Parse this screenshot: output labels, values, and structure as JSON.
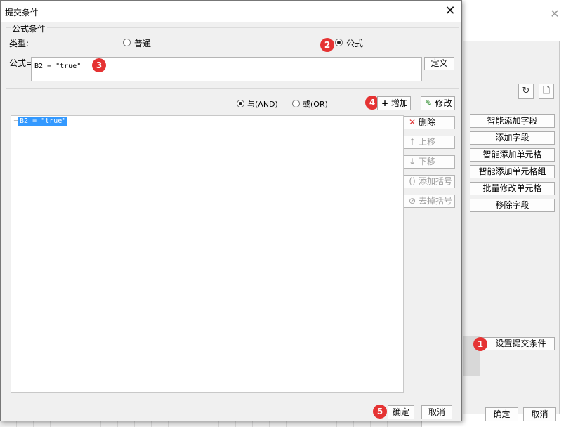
{
  "background_window": {
    "buttons": [
      "智能添加字段",
      "添加字段",
      "智能添加单元格",
      "智能添加单元格组",
      "批量修改单元格",
      "移除字段"
    ],
    "set_submit_button": "设置提交条件",
    "ok": "确定",
    "cancel": "取消"
  },
  "dialog": {
    "title": "提交条件",
    "group_label": "公式条件",
    "type_label": "类型:",
    "type_normal": "普通",
    "type_formula": "公式",
    "formula_label": "公式=",
    "formula_value": "B2 = \"true\"",
    "define_button": "定义",
    "and_label": "与(AND)",
    "or_label": "或(OR)",
    "add_button": "增加",
    "modify_button": "修改",
    "condition_rows": [
      "B2 = \"true\""
    ],
    "side_buttons": {
      "delete": "删除",
      "move_up": "上移",
      "move_down": "下移",
      "add_bracket": "添加括号",
      "remove_bracket": "去掉括号"
    },
    "ok": "确定",
    "cancel": "取消"
  },
  "badges": [
    "1",
    "2",
    "3",
    "4",
    "5"
  ],
  "colors": {
    "badge": "#e53333",
    "selection": "#3399ff",
    "delete_icon": "#e03030",
    "add_icon": "#000000"
  }
}
